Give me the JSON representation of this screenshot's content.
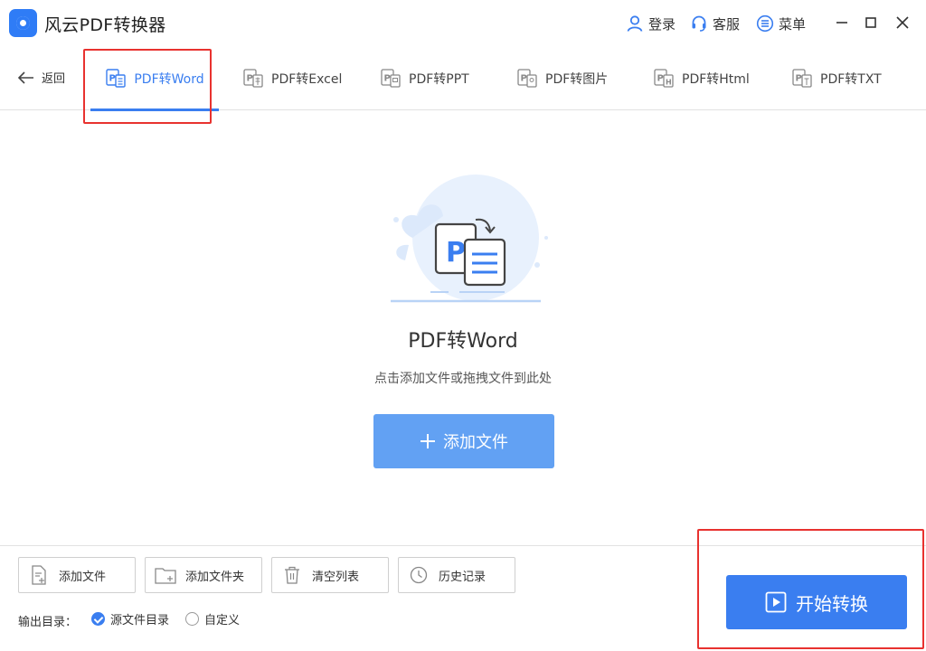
{
  "titlebar": {
    "app_title": "风云PDF转换器",
    "login_label": "登录",
    "service_label": "客服",
    "menu_label": "菜单"
  },
  "nav": {
    "back_label": "返回",
    "tabs": [
      {
        "label": "PDF转Word",
        "active": true
      },
      {
        "label": "PDF转Excel",
        "active": false
      },
      {
        "label": "PDF转PPT",
        "active": false
      },
      {
        "label": "PDF转图片",
        "active": false
      },
      {
        "label": "PDF转Html",
        "active": false
      },
      {
        "label": "PDF转TXT",
        "active": false
      }
    ]
  },
  "main": {
    "title": "PDF转Word",
    "hint": "点击添加文件或拖拽文件到此处",
    "add_button_label": "添加文件"
  },
  "toolbar": {
    "add_file_label": "添加文件",
    "add_folder_label": "添加文件夹",
    "clear_list_label": "清空列表",
    "history_label": "历史记录"
  },
  "output": {
    "label": "输出目录：",
    "options": [
      {
        "label": "源文件目录",
        "checked": true
      },
      {
        "label": "自定义",
        "checked": false
      }
    ]
  },
  "start_button_label": "开始转换",
  "colors": {
    "accent": "#3a7ef0",
    "add_button": "#62a1f3",
    "highlight_box": "#e8322f"
  }
}
